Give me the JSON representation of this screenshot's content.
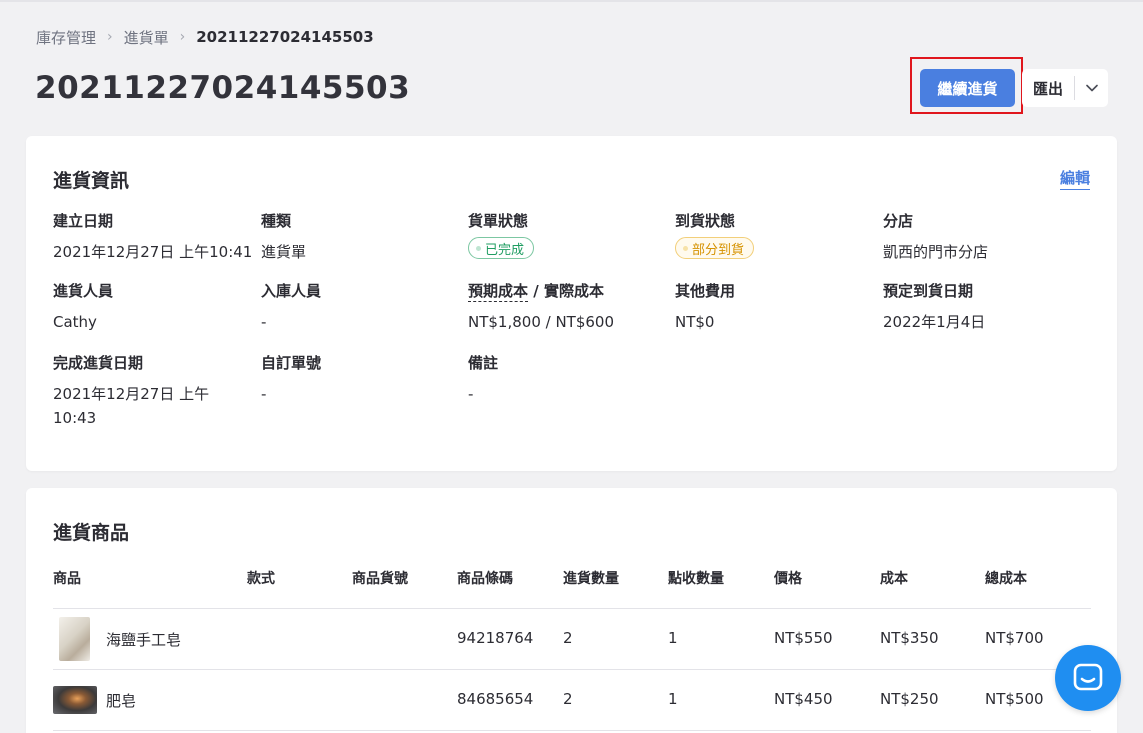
{
  "breadcrumb": {
    "items": [
      "庫存管理",
      "進貨單"
    ],
    "current": "20211227024145503"
  },
  "page": {
    "title": "20211227024145503"
  },
  "actions": {
    "continue_label": "繼續進貨",
    "export_label": "匯出"
  },
  "info": {
    "title": "進貨資訊",
    "edit_label": "編輯",
    "created_date_label": "建立日期",
    "created_date": "2021年12月27日 上午10:41",
    "type_label": "種類",
    "type": "進貨單",
    "order_status_label": "貨單狀態",
    "order_status": "已完成",
    "arrival_status_label": "到貨狀態",
    "arrival_status": "部分到貨",
    "branch_label": "分店",
    "branch": "凱西的門市分店",
    "purchaser_label": "進貨人員",
    "purchaser": "Cathy",
    "receiver_label": "入庫人員",
    "receiver": "-",
    "cost_label": "預期成本",
    "cost_label_sep": " / ",
    "cost_label_actual": "實際成本",
    "cost": "NT$1,800 / NT$600",
    "other_fee_label": "其他費用",
    "other_fee": "NT$0",
    "eta_label": "預定到貨日期",
    "eta": "2022年1月4日",
    "completed_date_label": "完成進貨日期",
    "completed_date": "2021年12月27日 上午 10:43",
    "custom_no_label": "自訂單號",
    "custom_no": "-",
    "note_label": "備註",
    "note": "-",
    "colors": {
      "done": "#1f9d62",
      "partial": "#d69200"
    }
  },
  "products": {
    "title": "進貨商品",
    "columns": [
      "商品",
      "款式",
      "商品貨號",
      "商品條碼",
      "進貨數量",
      "點收數量",
      "價格",
      "成本",
      "總成本"
    ],
    "rows": [
      {
        "name": "海鹽手工皂",
        "variant": "",
        "sku": "",
        "barcode": "94218764",
        "qty": "2",
        "received": "1",
        "price": "NT$550",
        "cost": "NT$350",
        "total": "NT$700"
      },
      {
        "name": "肥皂",
        "variant": "",
        "sku": "",
        "barcode": "84685654",
        "qty": "2",
        "received": "1",
        "price": "NT$450",
        "cost": "NT$250",
        "total": "NT$500"
      }
    ]
  },
  "theme": {
    "primary": "#4a7fe0",
    "highlight": "#e0161c",
    "chat": "#1f8ef1"
  }
}
